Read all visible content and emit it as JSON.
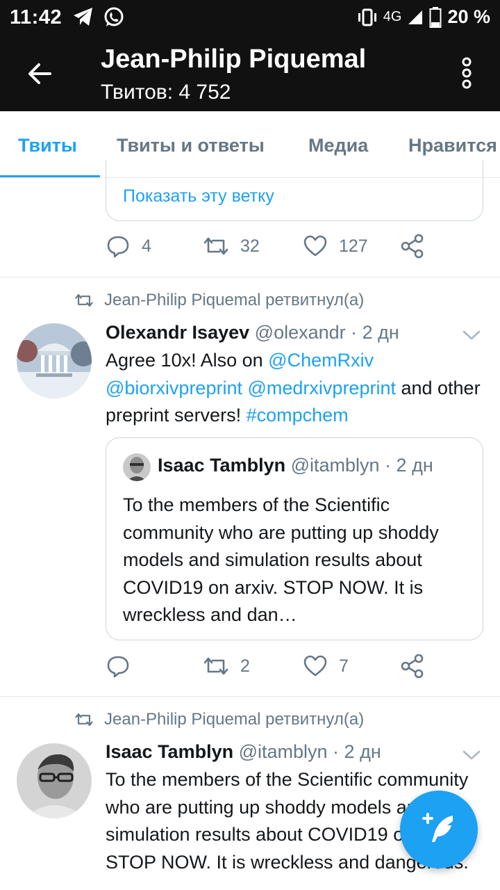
{
  "status_bar": {
    "time": "11:42",
    "network": "4G",
    "battery": "20 %",
    "icons": [
      "telegram-icon",
      "whatsapp-icon",
      "vibrate-icon",
      "signal-icon",
      "battery-icon"
    ]
  },
  "header": {
    "title": "Jean-Philip Piquemal",
    "subtitle": "Твитов: 4 752"
  },
  "tabs": [
    {
      "label": "Твиты",
      "active": true
    },
    {
      "label": "Твиты и ответы",
      "active": false
    },
    {
      "label": "Медиа",
      "active": false
    },
    {
      "label": "Нравится",
      "active": false
    }
  ],
  "first_tweet": {
    "show_thread": "Показать эту ветку",
    "replies": "4",
    "retweets": "32",
    "likes": "127"
  },
  "tweet1": {
    "retweeted_by": "Jean-Philip Piquemal ретвитнул(а)",
    "name": "Olexandr Isayev",
    "meta": "@olexandr · 2 дн",
    "text": {
      "t1": "Agree 10x! Also on ",
      "m1": "@ChemRxiv",
      "m2": "@biorxivpreprint",
      "m3": "@medrxivpreprint",
      "t2": " and other preprint servers! ",
      "h1": "#compchem"
    },
    "quote": {
      "name": "Isaac Tamblyn",
      "meta": "@itamblyn · 2 дн",
      "text": "To the members of the Scientific community who are putting up shoddy models and simulation results about COVID19 on arxiv. STOP NOW. It is wreckless and dan…"
    },
    "replies": "",
    "retweets": "2",
    "likes": "7"
  },
  "tweet2": {
    "retweeted_by": "Jean-Philip Piquemal ретвитнул(а)",
    "name": "Isaac Tamblyn",
    "meta": "@itamblyn · 2 дн",
    "text": "To the members of the Scientific community who are putting up shoddy models and simulation results about COVID19 on arxiv. STOP NOW. It is wreckless and dangerous."
  },
  "colors": {
    "accent": "#1da1f2",
    "header_bg": "#111111",
    "secondary_text": "#657786"
  }
}
